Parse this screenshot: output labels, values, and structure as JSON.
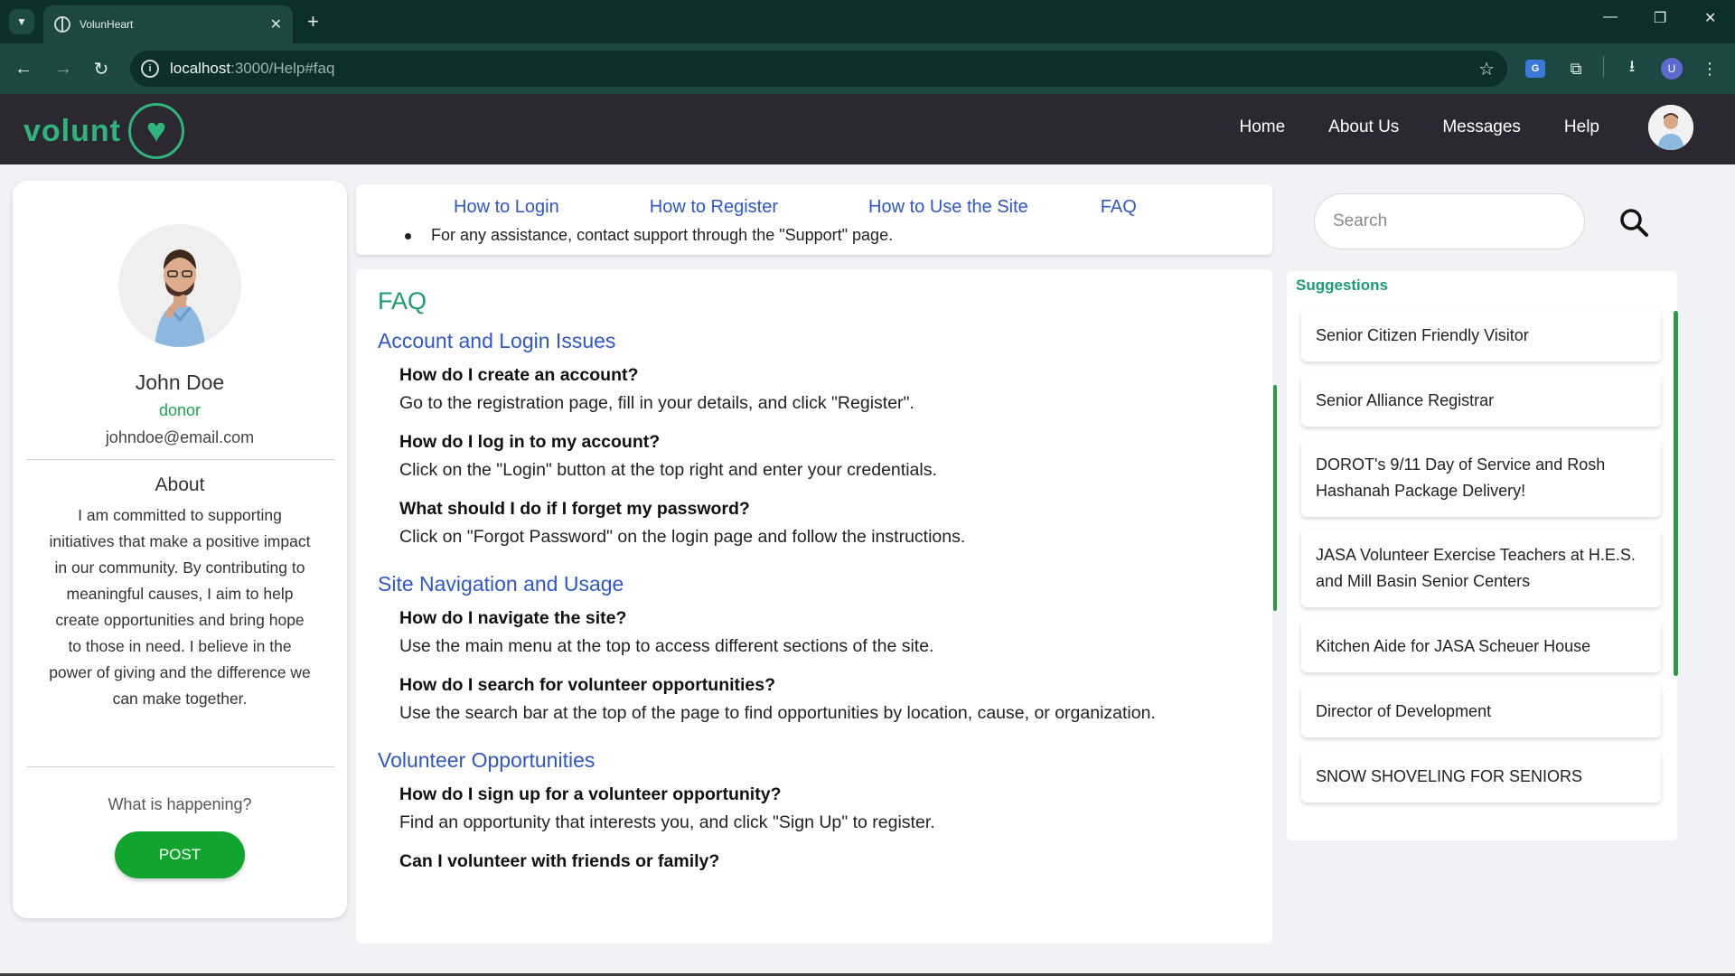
{
  "browser": {
    "tab_title": "VolunHeart",
    "url_host": "localhost",
    "url_path": ":3000/Help#faq",
    "profile_initial": "U",
    "translate_label": "G"
  },
  "header": {
    "brand": "volunt",
    "nav": [
      "Home",
      "About Us",
      "Messages",
      "Help"
    ]
  },
  "profile": {
    "name": "John Doe",
    "role": "donor",
    "email": "johndoe@email.com",
    "about_heading": "About",
    "about_text": "I am committed to supporting initiatives that make a positive impact in our community. By contributing to meaningful causes, I aim to help create opportunities and bring hope to those in need. I believe in the power of giving and the difference we can make together.",
    "prompt": "What is happening?",
    "post_label": "POST"
  },
  "help": {
    "tabs": [
      "How to Login",
      "How to Register",
      "How to Use the Site",
      "FAQ"
    ],
    "cut_line": "For any assistance, contact support through the \"Support\" page.",
    "faq_title": "FAQ",
    "sections": [
      {
        "title": "Account and Login Issues",
        "items": [
          {
            "q": "How do I create an account?",
            "a": "Go to the registration page, fill in your details, and click \"Register\"."
          },
          {
            "q": "How do I log in to my account?",
            "a": "Click on the \"Login\" button at the top right and enter your credentials."
          },
          {
            "q": "What should I do if I forget my password?",
            "a": "Click on \"Forgot Password\" on the login page and follow the instructions."
          }
        ]
      },
      {
        "title": "Site Navigation and Usage",
        "items": [
          {
            "q": "How do I navigate the site?",
            "a": "Use the main menu at the top to access different sections of the site."
          },
          {
            "q": "How do I search for volunteer opportunities?",
            "a": "Use the search bar at the top of the page to find opportunities by location, cause, or organization."
          }
        ]
      },
      {
        "title": "Volunteer Opportunities",
        "items": [
          {
            "q": "How do I sign up for a volunteer opportunity?",
            "a": "Find an opportunity that interests you, and click \"Sign Up\" to register."
          },
          {
            "q": "Can I volunteer with friends or family?",
            "a": ""
          }
        ]
      }
    ]
  },
  "search": {
    "placeholder": "Search"
  },
  "suggestions": {
    "heading": "Suggestions",
    "items": [
      "Senior Citizen Friendly Visitor",
      "Senior Alliance Registrar",
      "DOROT's 9/11 Day of Service and Rosh Hashanah Package Delivery!",
      "JASA Volunteer Exercise Teachers at H.E.S. and Mill Basin Senior Centers",
      "Kitchen Aide for JASA Scheuer House",
      "Director of Development",
      "SNOW SHOVELING FOR SENIORS"
    ]
  },
  "colors": {
    "brand_green": "#2fb57c",
    "link_blue": "#2f57c9",
    "post_green": "#11a52e",
    "header_bg": "#2c2831",
    "browser_bg": "#1c4742"
  }
}
